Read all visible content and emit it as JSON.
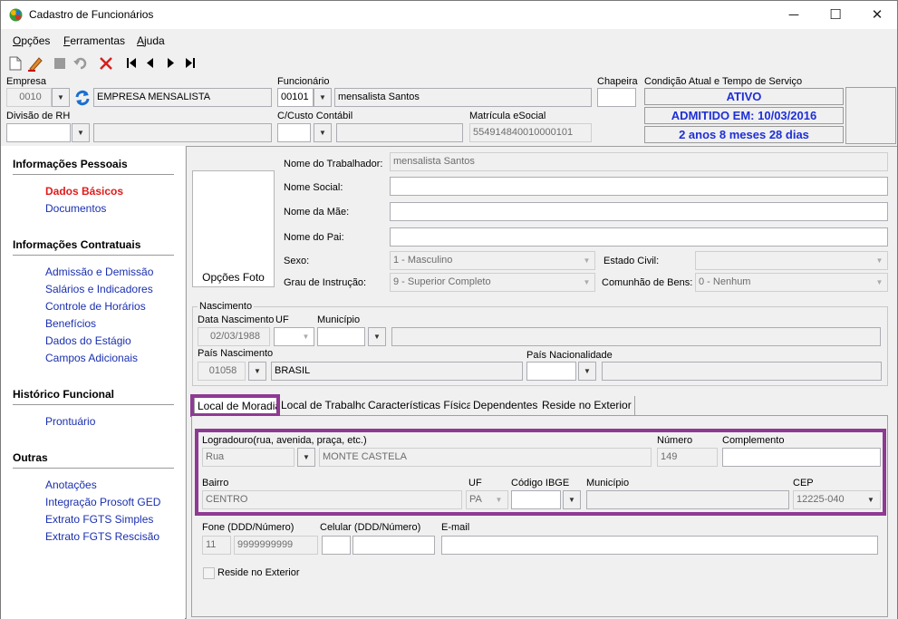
{
  "window": {
    "title": "Cadastro de Funcionários",
    "minimize": "─",
    "maximize": "☐",
    "close": "✕"
  },
  "menu": {
    "items": [
      {
        "key": "O",
        "rest": "pções"
      },
      {
        "key": "F",
        "rest": "erramentas"
      },
      {
        "key": "A",
        "rest": "juda"
      }
    ]
  },
  "toolbar": {
    "icons": [
      "new-icon",
      "edit-icon",
      "stop-icon",
      "undo-icon",
      "delete-icon",
      "first-icon",
      "prev-icon",
      "next-icon",
      "last-icon"
    ]
  },
  "header": {
    "empresa_label": "Empresa",
    "empresa_code": "0010",
    "empresa_name": "EMPRESA MENSALISTA",
    "funcionario_label": "Funcionário",
    "funcionario_code": "00101",
    "funcionario_name": "mensalista Santos",
    "chapeira_label": "Chapeira",
    "chapeira_value": "",
    "condicao_label": "Condição Atual e Tempo de Serviço",
    "status": "ATIVO",
    "admitido": "ADMITIDO EM: 10/03/2016",
    "tempo": "2 anos 8 meses 28 dias",
    "divisao_label": "Divisão de RH",
    "divisao_code": "",
    "divisao_name": "",
    "ccusto_label": "C/Custo Contábil",
    "ccusto_code": "",
    "ccusto_name": "",
    "matricula_label": "Matrícula eSocial",
    "matricula_value": "554914840010000101"
  },
  "nav": {
    "sections": [
      {
        "title": "Informações Pessoais",
        "links": [
          "Dados Básicos",
          "Documentos"
        ]
      },
      {
        "title": "Informações Contratuais",
        "links": [
          "Admissão e Demissão",
          "Salários e Indicadores",
          "Controle de Horários",
          "Benefícios",
          "Dados do Estágio",
          "Campos Adicionais"
        ]
      },
      {
        "title": "Histórico Funcional",
        "links": [
          "Prontuário"
        ]
      },
      {
        "title": "Outras",
        "links": [
          "Anotações",
          "Integração Prosoft GED",
          "Extrato FGTS Simples",
          "Extrato FGTS Rescisão"
        ]
      }
    ],
    "active": "Dados Básicos"
  },
  "basic": {
    "photo_button": "Opções Foto",
    "nome_trabalhador_label": "Nome do Trabalhador:",
    "nome_trabalhador": "mensalista Santos",
    "nome_social_label": "Nome Social:",
    "nome_social": "",
    "nome_mae_label": "Nome da Mãe:",
    "nome_mae": "",
    "nome_pai_label": "Nome do Pai:",
    "nome_pai": "",
    "sexo_label": "Sexo:",
    "sexo": "1 - Masculino",
    "estado_civil_label": "Estado Civil:",
    "estado_civil": "",
    "grau_label": "Grau de Instrução:",
    "grau": "9 - Superior Completo",
    "comunhao_label": "Comunhão de Bens:",
    "comunhao": "0 - Nenhum"
  },
  "nascimento": {
    "group_label": "Nascimento",
    "data_label": "Data Nascimento",
    "data": "02/03/1988",
    "uf_label": "UF",
    "uf": "",
    "municipio_label": "Município",
    "municipio_code": "",
    "municipio_name": "",
    "pais_label": "País Nascimento",
    "pais_code": "01058",
    "pais_name": "BRASIL",
    "nacionalidade_label": "País Nacionalidade",
    "nacionalidade_code": "",
    "nacionalidade_name": ""
  },
  "tabs": [
    "Local de Moradia",
    "Local de Trabalho",
    "Características Físicas",
    "Dependentes",
    "Reside no Exterior"
  ],
  "endereco": {
    "logradouro_label": "Logradouro(rua, avenida, praça, etc.)",
    "tipo": "Rua",
    "logradouro": "MONTE CASTELA",
    "numero_label": "Número",
    "numero": "149",
    "complemento_label": "Complemento",
    "complemento": "",
    "bairro_label": "Bairro",
    "bairro": "CENTRO",
    "uf_label": "UF",
    "uf": "PA",
    "ibge_label": "Código IBGE",
    "ibge": "",
    "municipio_label": "Município",
    "municipio": "",
    "cep_label": "CEP",
    "cep": "12225-040",
    "fone_label": "Fone (DDD/Número)",
    "fone_ddd": "11",
    "fone_num": "9999999999",
    "celular_label": "Celular (DDD/Número)",
    "celular_ddd": "",
    "celular_num": "",
    "email_label": "E-mail",
    "email": "",
    "reside_label": "Reside no Exterior"
  },
  "colors": {
    "highlight": "#8e3a93",
    "status_blue": "#1e2fd6",
    "nav_link": "#1a2fb0",
    "nav_active": "#e21b1b"
  }
}
